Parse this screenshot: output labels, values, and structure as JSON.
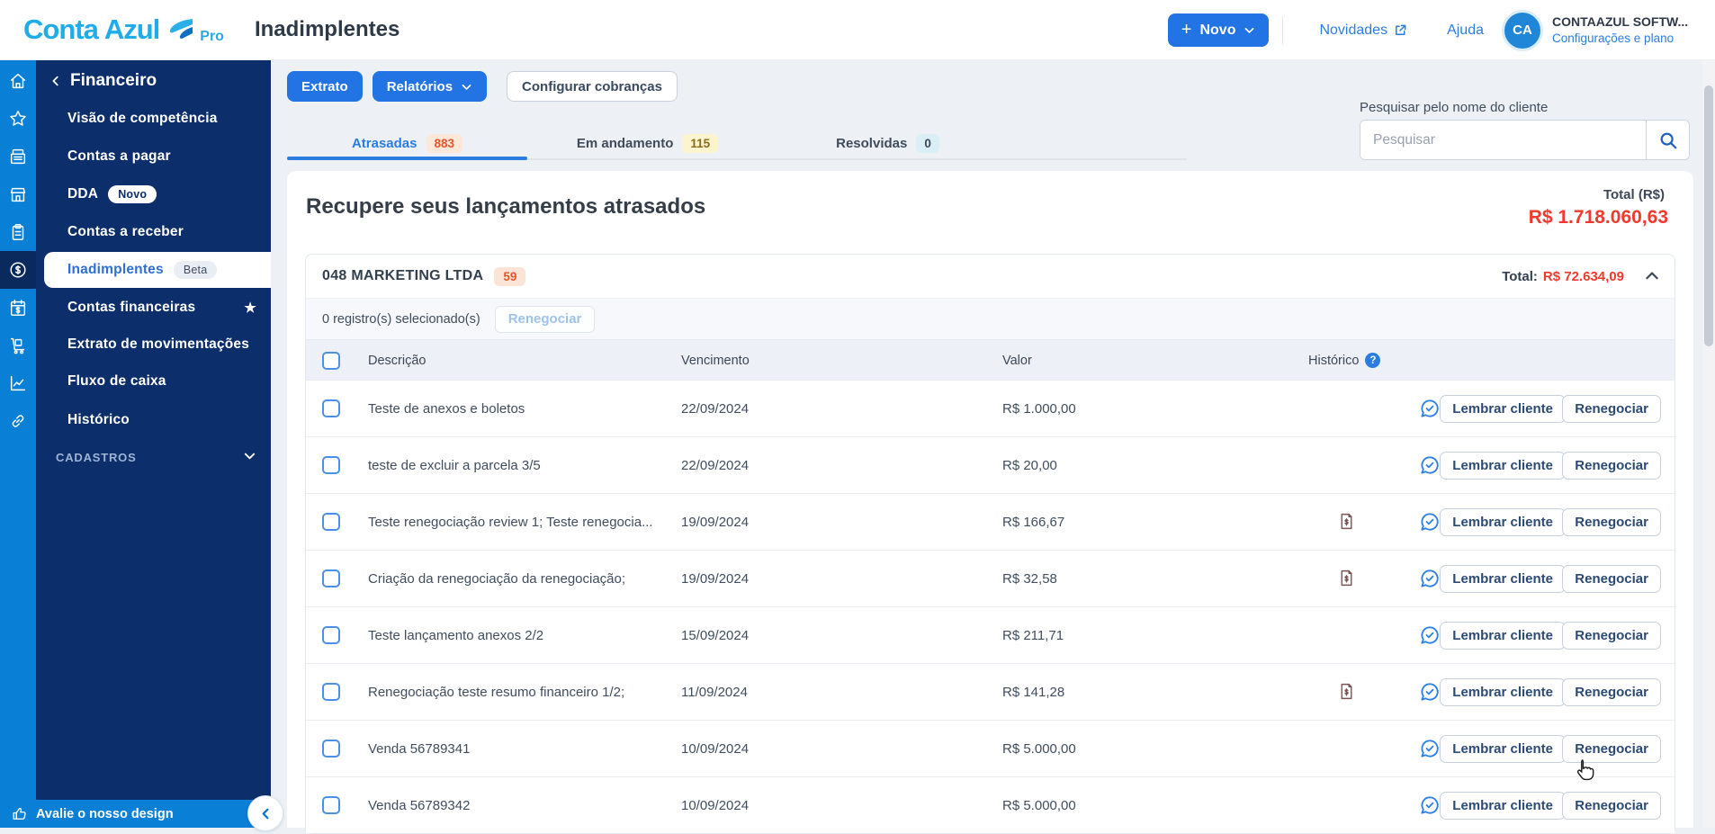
{
  "header": {
    "logo": {
      "part1": "Conta",
      "part2": "Azul",
      "suffix": "Pro"
    },
    "page_title": "Inadimplentes",
    "novo_button": "Novo",
    "novidades_link": "Novidades",
    "ajuda_link": "Ajuda",
    "avatar_initials": "CA",
    "account_name": "CONTAAZUL SOFTW...",
    "account_settings": "Configurações e plano"
  },
  "sidebar": {
    "rail": [
      {
        "icon": "home"
      },
      {
        "icon": "star"
      },
      {
        "icon": "cash-register"
      },
      {
        "icon": "store"
      },
      {
        "icon": "clipboard"
      },
      {
        "icon": "dollar-circle",
        "selected": true
      },
      {
        "icon": "calendar-dollar"
      },
      {
        "icon": "cart"
      },
      {
        "icon": "chart-line"
      },
      {
        "icon": "link"
      }
    ],
    "section_title": "Financeiro",
    "items": [
      {
        "label": "Visão de competência"
      },
      {
        "label": "Contas a pagar"
      },
      {
        "label": "DDA",
        "badge": "Novo",
        "badge_style": "novo"
      },
      {
        "label": "Contas a receber"
      },
      {
        "label": "Inadimplentes",
        "badge": "Beta",
        "badge_style": "beta",
        "selected": true
      },
      {
        "label": "Contas financeiras",
        "star": true
      },
      {
        "label": "Extrato de movimentações"
      },
      {
        "label": "Fluxo de caixa"
      },
      {
        "label": "Histórico"
      }
    ],
    "collapsed_section": "CADASTROS",
    "rate_design": "Avalie o nosso design"
  },
  "toolbar": {
    "extrato": "Extrato",
    "relatorios": "Relatórios",
    "configurar": "Configurar cobranças"
  },
  "tabs": [
    {
      "label": "Atrasadas",
      "count": "883",
      "badge_bg": "#fde7d9",
      "badge_color": "#e8552c",
      "selected": true
    },
    {
      "label": "Em andamento",
      "count": "115",
      "badge_bg": "#fcf3cf",
      "badge_color": "#8a6d1a"
    },
    {
      "label": "Resolvidas",
      "count": "0",
      "badge_bg": "#d9eef5",
      "badge_color": "#3c4858"
    }
  ],
  "search": {
    "label": "Pesquisar pelo nome do cliente",
    "placeholder": "Pesquisar"
  },
  "summary": {
    "total_label": "Total (R$)",
    "total_value": "R$ 1.718.060,63"
  },
  "section": {
    "heading": "Recupere seus lançamentos atrasados"
  },
  "group": {
    "name": "048 MARKETING LTDA",
    "count": "59",
    "total_label": "Total:",
    "total_value": "R$ 72.634,09"
  },
  "selection": {
    "text": "0 registro(s) selecionado(s)",
    "renegociar_label": "Renegociar"
  },
  "table": {
    "headers": {
      "desc": "Descrição",
      "due": "Vencimento",
      "value": "Valor",
      "history": "Histórico"
    },
    "lembrar_label": "Lembrar cliente",
    "renegociar_label": "Renegociar",
    "rows": [
      {
        "desc": "Teste de anexos e boletos",
        "due": "22/09/2024",
        "value": "R$ 1.000,00",
        "has_history": false
      },
      {
        "desc": "teste de excluir a parcela 3/5",
        "due": "22/09/2024",
        "value": "R$ 20,00",
        "has_history": false
      },
      {
        "desc": "Teste renegociação review 1; Teste renegocia...",
        "due": "19/09/2024",
        "value": "R$ 166,67",
        "has_history": true
      },
      {
        "desc": "Criação da renegociação da renegociação;",
        "due": "19/09/2024",
        "value": "R$ 32,58",
        "has_history": true
      },
      {
        "desc": "Teste lançamento anexos 2/2",
        "due": "15/09/2024",
        "value": "R$ 211,71",
        "has_history": false
      },
      {
        "desc": "Renegociação teste resumo financeiro 1/2;",
        "due": "11/09/2024",
        "value": "R$ 141,28",
        "has_history": true
      },
      {
        "desc": "Venda 56789341",
        "due": "10/09/2024",
        "value": "R$ 5.000,00",
        "has_history": false
      },
      {
        "desc": "Venda 56789342",
        "due": "10/09/2024",
        "value": "R$ 5.000,00",
        "has_history": false
      }
    ]
  },
  "colors": {
    "accent": "#2273e3",
    "danger": "#f1392d",
    "sidebar_navy": "#0c2f6b",
    "rail_blue": "#0a7fd6"
  }
}
